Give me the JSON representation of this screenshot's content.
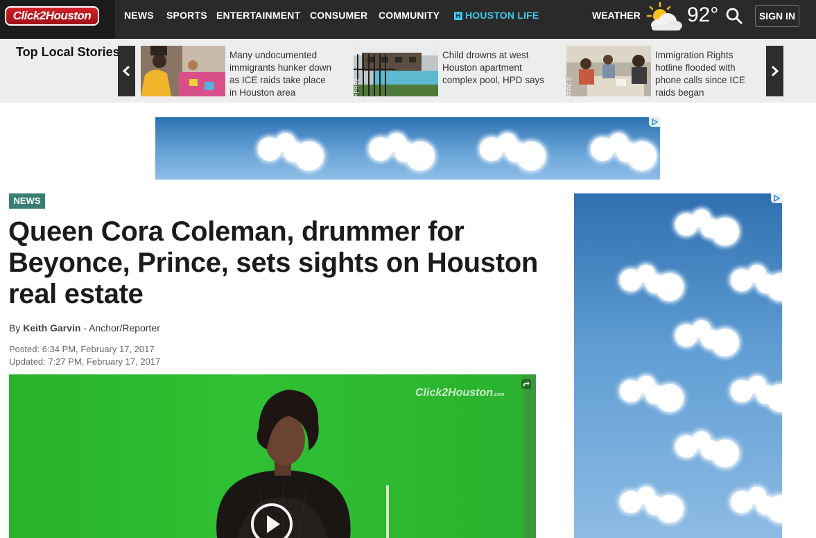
{
  "brand": {
    "logo_text": "Click2Houston"
  },
  "nav": {
    "items": [
      {
        "label": "NEWS"
      },
      {
        "label": "SPORTS"
      },
      {
        "label": "ENTERTAINMENT"
      },
      {
        "label": "CONSUMER"
      },
      {
        "label": "COMMUNITY"
      }
    ],
    "houston_life": {
      "badge": "H",
      "label": "HOUSTON LIFE"
    },
    "weather": {
      "label": "WEATHER",
      "icon": "partly-cloudy-icon",
      "temperature": "92°"
    },
    "search_icon": "search-icon",
    "signin_label": "SIGN IN"
  },
  "top_stories": {
    "title": "Top Local Stories",
    "stories": [
      {
        "text": "Many undocumented immigrants hunker down as ICE raids take place in Houston area"
      },
      {
        "text": "Child drowns at west Houston apartment complex pool, HPD says",
        "watermark": "KPRC2"
      },
      {
        "text": "Immigration Rights hotline flooded with phone calls since ICE raids began",
        "watermark": "KPRC 2"
      }
    ],
    "prev_icon": "chevron-left-icon",
    "next_icon": "chevron-right-icon"
  },
  "article": {
    "category": "NEWS",
    "headline": "Queen Cora Coleman, drummer for Beyonce, Prince, sets sights on Houston real estate",
    "byline_prefix": "By",
    "author": "Keith Garvin",
    "author_title": " - Anchor/Reporter",
    "posted": "Posted: 6:34 PM, February 17, 2017",
    "updated": "Updated: 7:27 PM, February 17, 2017"
  },
  "video": {
    "watermark": "Click2Houston",
    "watermark_suffix": ".com",
    "share_icon": "share-icon",
    "play_icon": "play-icon"
  },
  "ads": {
    "choices_icon": "adchoices-icon"
  },
  "colors": {
    "nav_bg": "#2a2a2a",
    "accent_cyan": "#3ec7e8",
    "badge_teal": "#3a7d73",
    "logo_red": "#d11f26",
    "video_green": "#2fc133"
  }
}
